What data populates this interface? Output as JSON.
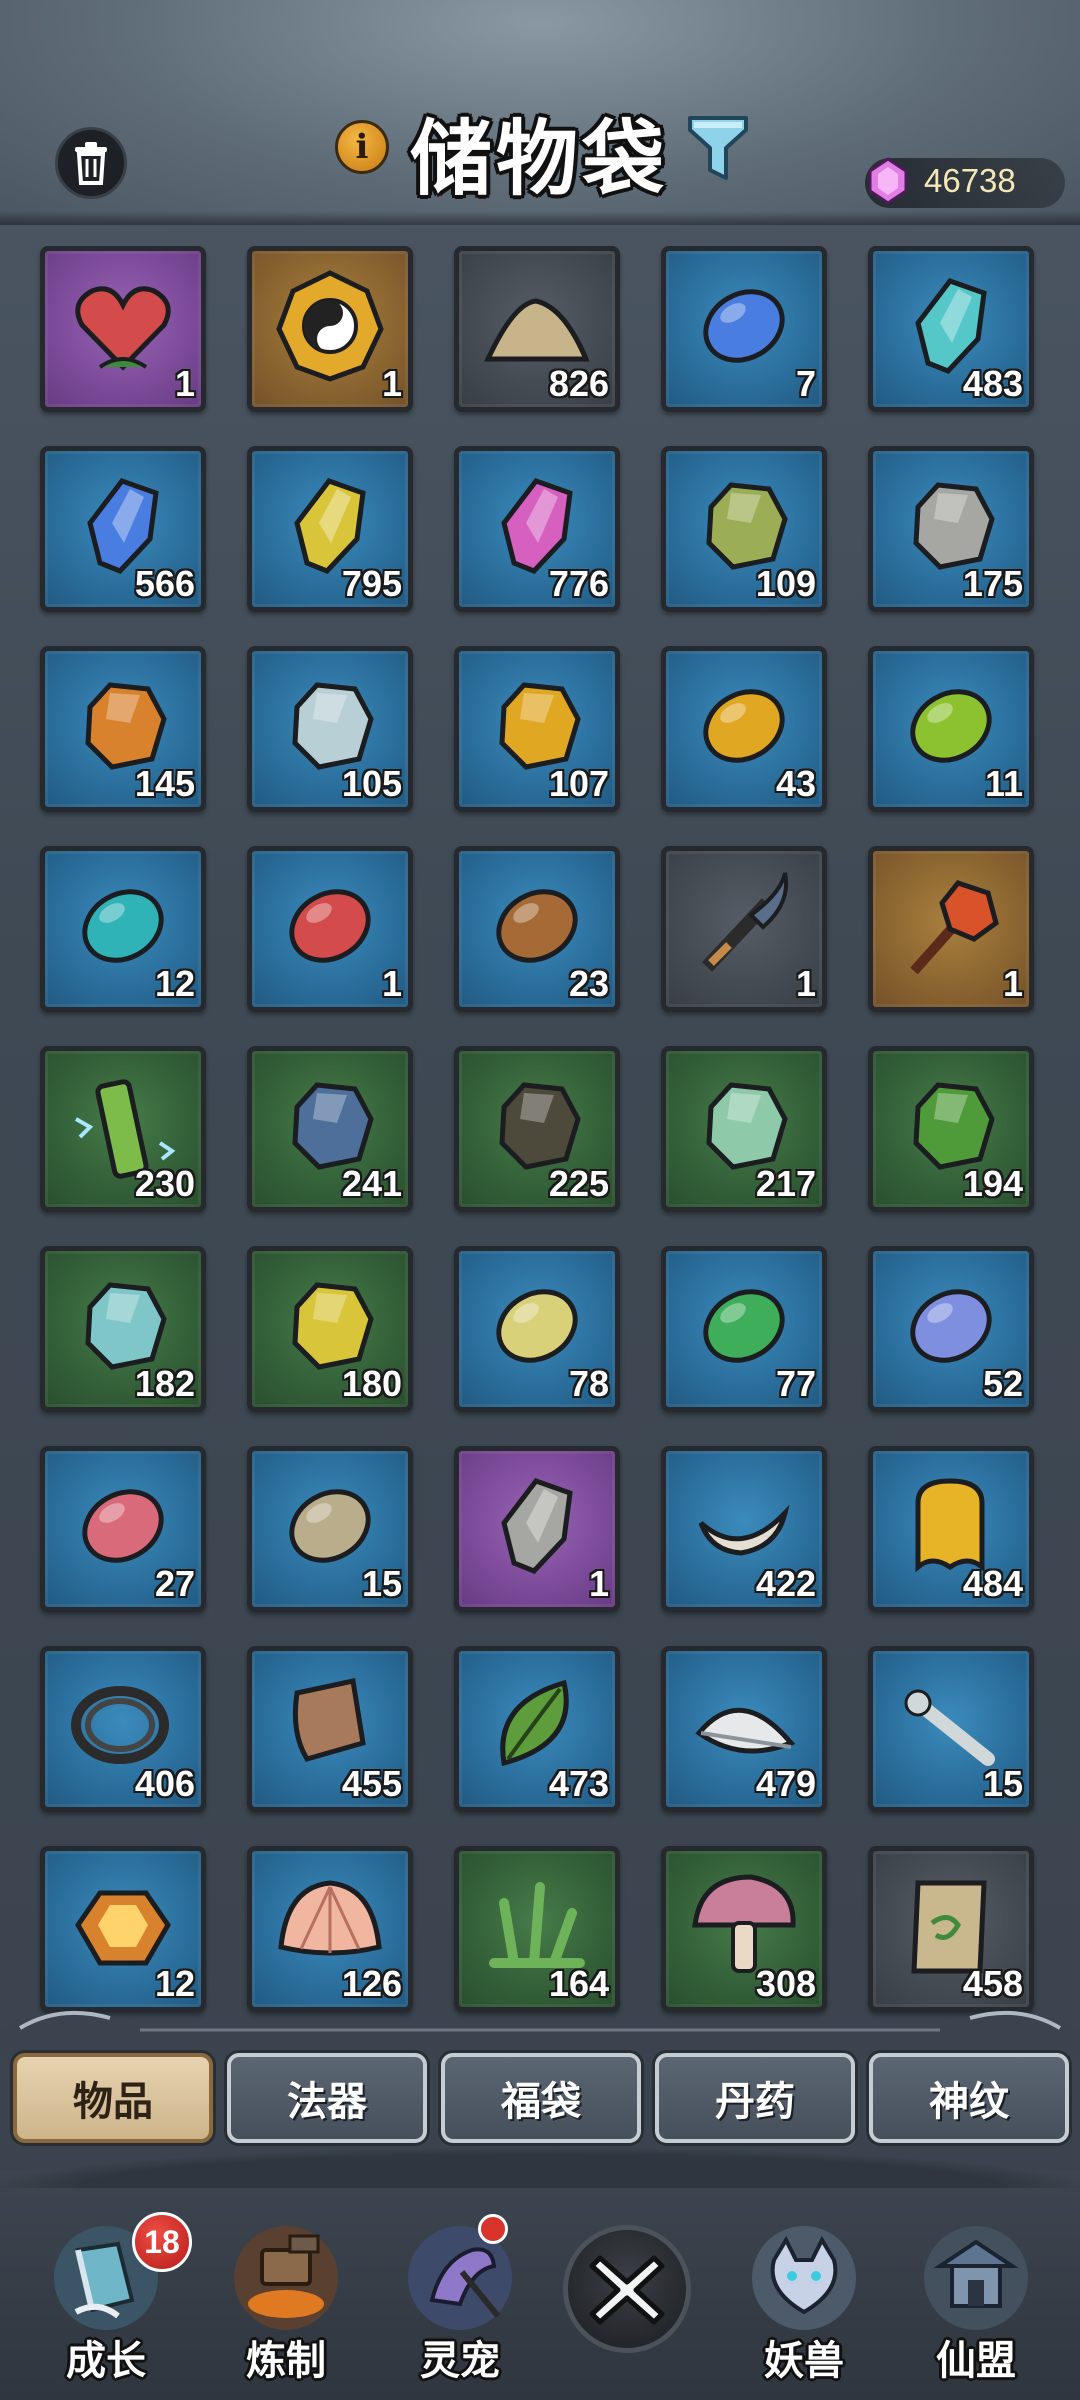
{
  "header": {
    "title": "储物袋",
    "info_icon": "i",
    "currency_icon": "spirit-gem-icon",
    "currency_amount": "46738"
  },
  "items": [
    {
      "icon": "red-heart-fruit-icon",
      "rarity": "purple",
      "count": "1"
    },
    {
      "icon": "taiji-compass-icon",
      "rarity": "gold",
      "count": "1"
    },
    {
      "icon": "sand-pile-icon",
      "rarity": "gray",
      "count": "826"
    },
    {
      "icon": "cracked-blue-egg-icon",
      "rarity": "blue",
      "count": "7"
    },
    {
      "icon": "cyan-crystal-icon",
      "rarity": "blue",
      "count": "483"
    },
    {
      "icon": "blue-crystal-icon",
      "rarity": "blue",
      "count": "566"
    },
    {
      "icon": "yellow-crystal-icon",
      "rarity": "blue",
      "count": "795"
    },
    {
      "icon": "pink-crystal-icon",
      "rarity": "blue",
      "count": "776"
    },
    {
      "icon": "mossy-ore-icon",
      "rarity": "blue",
      "count": "109"
    },
    {
      "icon": "gray-ore-icon",
      "rarity": "blue",
      "count": "175"
    },
    {
      "icon": "amber-ore-icon",
      "rarity": "blue",
      "count": "145"
    },
    {
      "icon": "silver-ore-icon",
      "rarity": "blue",
      "count": "105"
    },
    {
      "icon": "gold-ore-icon",
      "rarity": "blue",
      "count": "107"
    },
    {
      "icon": "gold-pebble-icon",
      "rarity": "blue",
      "count": "43"
    },
    {
      "icon": "green-pebble-icon",
      "rarity": "blue",
      "count": "11"
    },
    {
      "icon": "teal-pebble-icon",
      "rarity": "blue",
      "count": "12"
    },
    {
      "icon": "red-pebble-icon",
      "rarity": "blue",
      "count": "1"
    },
    {
      "icon": "brown-pebble-icon",
      "rarity": "blue",
      "count": "23"
    },
    {
      "icon": "curved-blade-icon",
      "rarity": "gray",
      "count": "1"
    },
    {
      "icon": "flame-mace-icon",
      "rarity": "gold",
      "count": "1"
    },
    {
      "icon": "thunder-bamboo-icon",
      "rarity": "green",
      "count": "230"
    },
    {
      "icon": "blue-stone-icon",
      "rarity": "green",
      "count": "241"
    },
    {
      "icon": "dark-stone-icon",
      "rarity": "green",
      "count": "225"
    },
    {
      "icon": "jade-stone-icon",
      "rarity": "green",
      "count": "217"
    },
    {
      "icon": "green-stone-icon",
      "rarity": "green",
      "count": "194"
    },
    {
      "icon": "aqua-stone-icon",
      "rarity": "green",
      "count": "182"
    },
    {
      "icon": "yellow-stone-icon",
      "rarity": "green",
      "count": "180"
    },
    {
      "icon": "pale-yellow-pebble-icon",
      "rarity": "blue",
      "count": "78"
    },
    {
      "icon": "emerald-pebble-icon",
      "rarity": "blue",
      "count": "77"
    },
    {
      "icon": "blue-violet-pebble-icon",
      "rarity": "blue",
      "count": "52"
    },
    {
      "icon": "rose-pebble-icon",
      "rarity": "blue",
      "count": "27"
    },
    {
      "icon": "tan-pebble-icon",
      "rarity": "blue",
      "count": "15"
    },
    {
      "icon": "spiral-crystal-icon",
      "rarity": "purple",
      "count": "1"
    },
    {
      "icon": "beast-horn-icon",
      "rarity": "blue",
      "count": "422"
    },
    {
      "icon": "gold-slime-icon",
      "rarity": "blue",
      "count": "484"
    },
    {
      "icon": "rope-coil-icon",
      "rarity": "blue",
      "count": "406"
    },
    {
      "icon": "leather-hide-icon",
      "rarity": "blue",
      "count": "455"
    },
    {
      "icon": "green-leaf-icon",
      "rarity": "blue",
      "count": "473"
    },
    {
      "icon": "white-feather-icon",
      "rarity": "blue",
      "count": "479"
    },
    {
      "icon": "bone-branch-icon",
      "rarity": "blue",
      "count": "15"
    },
    {
      "icon": "amber-gem-icon",
      "rarity": "blue",
      "count": "12"
    },
    {
      "icon": "scallop-shell-icon",
      "rarity": "blue",
      "count": "126"
    },
    {
      "icon": "herb-grass-icon",
      "rarity": "green",
      "count": "164"
    },
    {
      "icon": "pink-mushroom-icon",
      "rarity": "green",
      "count": "308"
    },
    {
      "icon": "ancient-scroll-icon",
      "rarity": "gray",
      "count": "458"
    }
  ],
  "tabs": [
    {
      "label": "物品",
      "active": true
    },
    {
      "label": "法器",
      "active": false
    },
    {
      "label": "福袋",
      "active": false
    },
    {
      "label": "丹药",
      "active": false
    },
    {
      "label": "神纹",
      "active": false
    }
  ],
  "nav": {
    "growth": {
      "label": "成长",
      "icon": "growth-scroll-icon",
      "badge": "18"
    },
    "refine": {
      "label": "炼制",
      "icon": "forge-anvil-icon"
    },
    "pet": {
      "label": "灵宠",
      "icon": "spirit-pet-icon"
    },
    "close": {
      "icon": "close-x-icon"
    },
    "beast": {
      "label": "妖兽",
      "icon": "demon-beast-icon"
    },
    "alliance": {
      "label": "仙盟",
      "icon": "alliance-pagoda-icon"
    }
  },
  "colors": {
    "slot_blue": "#2a6d9a",
    "slot_green": "#335f38",
    "slot_purple": "#7b4a98",
    "slot_gold": "#8a6430",
    "slot_gray": "#444a52",
    "tab_active": "#e1caa0",
    "badge_red": "#d8342b"
  }
}
